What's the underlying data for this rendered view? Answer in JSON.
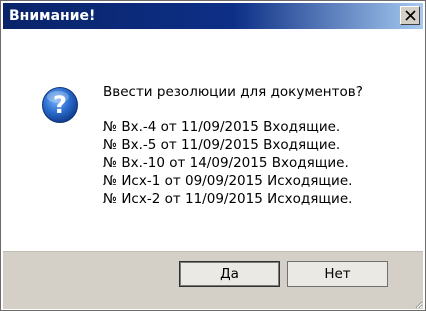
{
  "dialog": {
    "title": "Внимание!",
    "question": "Ввести резолюции для документов?",
    "documents": [
      "№ Вх.-4 от 11/09/2015 Входящие.",
      "№ Вх.-5 от 11/09/2015 Входящие.",
      "№ Вх.-10 от 14/09/2015 Входящие.",
      "№ Исх-1 от 09/09/2015 Исходящие.",
      "№ Исх-2 от 11/09/2015 Исходящие."
    ],
    "icon": "question-icon",
    "buttons": {
      "yes_label": "Да",
      "no_label": "Нет"
    }
  },
  "colors": {
    "title_bar_start": "#0a246a",
    "title_bar_end": "#a6caf0",
    "footer_bg": "#d4d0c8",
    "icon_blue": "#2b6fd1"
  }
}
